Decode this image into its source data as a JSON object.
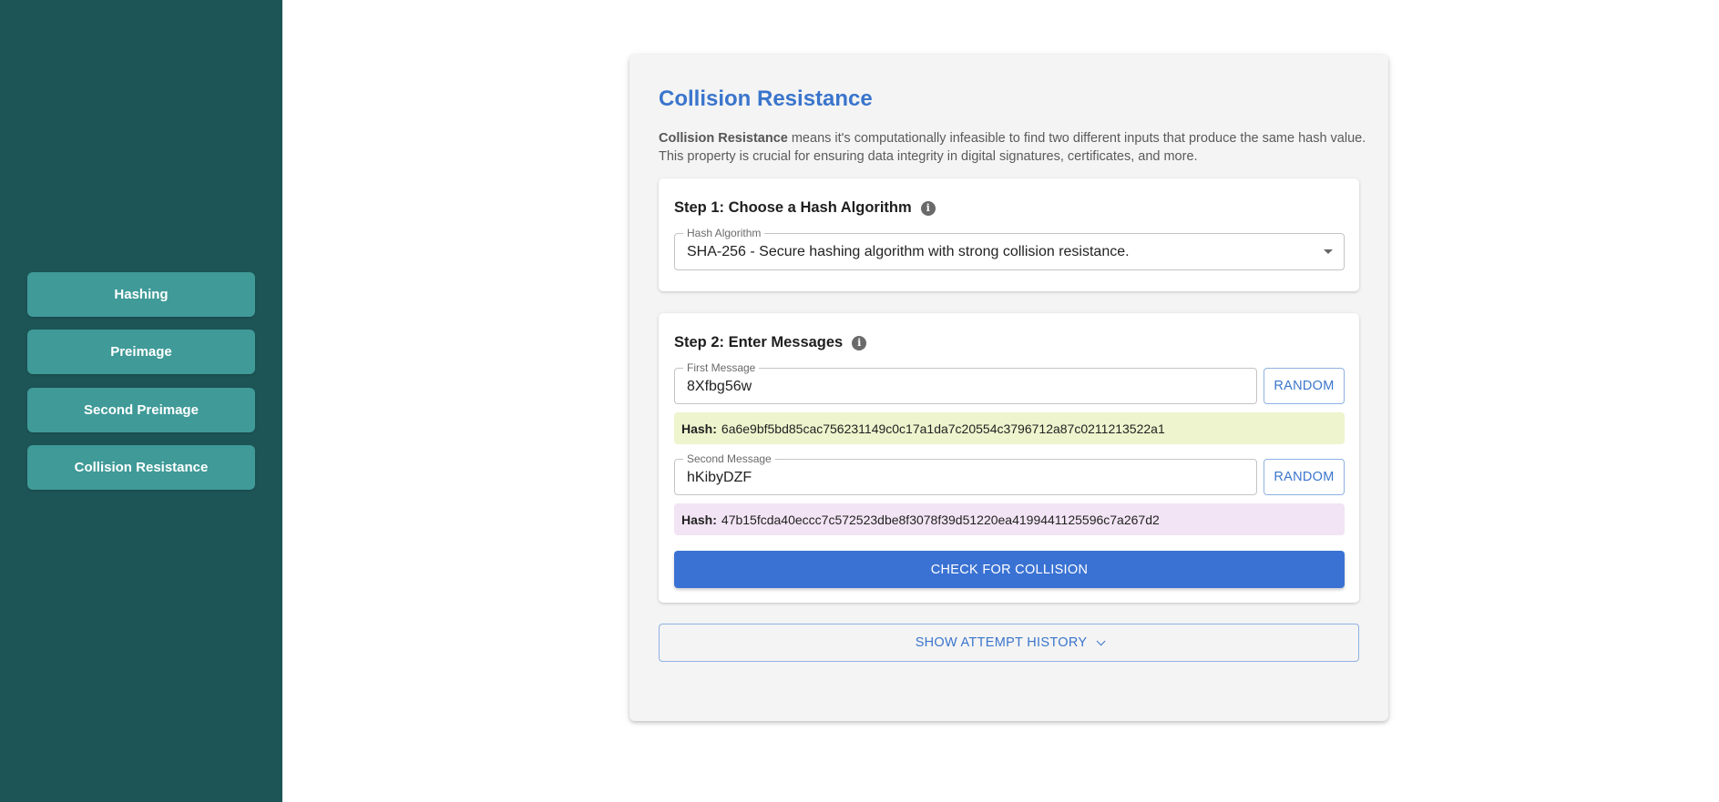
{
  "sidebar": {
    "items": [
      {
        "label": "Hashing"
      },
      {
        "label": "Preimage"
      },
      {
        "label": "Second Preimage"
      },
      {
        "label": "Collision Resistance"
      }
    ]
  },
  "main": {
    "title": "Collision Resistance",
    "description_bold": "Collision Resistance",
    "description_rest": " means it's computationally infeasible to find two different inputs that produce the same hash value. This property is crucial for ensuring data integrity in digital signatures, certificates, and more.",
    "step1": {
      "title": "Step 1: Choose a Hash Algorithm",
      "info_icon": "info-icon",
      "select_label": "Hash Algorithm",
      "select_value": "SHA-256 - Secure hashing algorithm with strong collision resistance."
    },
    "step2": {
      "title": "Step 2: Enter Messages",
      "info_icon": "info-icon",
      "first_label": "First Message",
      "first_value": "8Xfbg56w",
      "first_hash_label": "Hash:",
      "first_hash": "6a6e9bf5bd85cac756231149c0c17a1da7c20554c3796712a87c0211213522a1",
      "second_label": "Second Message",
      "second_value": "hKibyDZF",
      "second_hash_label": "Hash:",
      "second_hash": "47b15fcda40eccc7c572523dbe8f3078f39d51220ea4199441125596c7a267d2",
      "random_label": "RANDOM",
      "check_label": "CHECK FOR COLLISION"
    },
    "history_label": "SHOW ATTEMPT HISTORY"
  },
  "colors": {
    "sidebar_bg": "#1d5456",
    "nav_button": "#3f9a98",
    "accent": "#3a75cc",
    "hash1_bg": "#eef4cd",
    "hash2_bg": "#f2e4f4"
  }
}
